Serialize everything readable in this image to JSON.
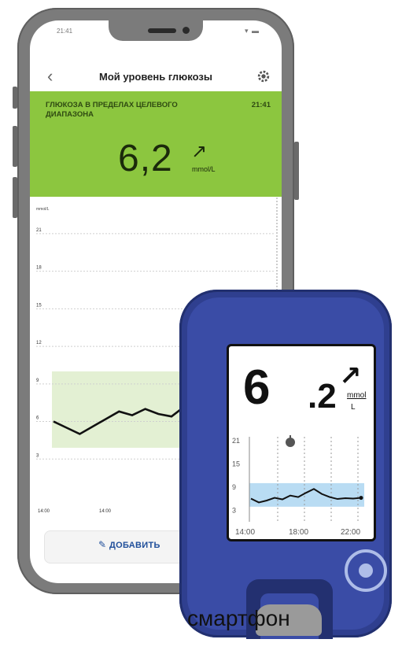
{
  "phone": {
    "status_time": "21:41",
    "status_icons": "▾ ▬",
    "header": {
      "back_glyph": "‹",
      "title": "Мой уровень глюкозы"
    },
    "banner": {
      "status_text": "ГЛЮКОЗА В ПРЕДЕЛАХ ЦЕЛЕВОГО ДИАПАЗОНА",
      "time": "21:41",
      "value": "6,2",
      "trend_arrow": "↗",
      "unit": "mmol/L",
      "color": "#8cc63f"
    },
    "chart_data": {
      "type": "line",
      "unit_label": "mmol/L",
      "y_ticks": [
        "21",
        "18",
        "15",
        "12",
        "9",
        "6",
        "3"
      ],
      "x_ticks": [
        "14:00",
        "14:00",
        "",
        ""
      ],
      "target_range": [
        3.9,
        10.0
      ],
      "ylim": [
        0,
        22
      ],
      "series": [
        {
          "values": [
            6.0,
            5.5,
            5.0,
            5.6,
            6.2,
            6.8,
            6.5,
            7.0,
            6.6,
            6.4,
            7.2,
            8.0,
            9.5
          ]
        }
      ]
    },
    "add_button_label": "ДОБАВИТЬ"
  },
  "reader": {
    "value_int": "6",
    "value_dec": ".2",
    "trend_arrow": "↗",
    "unit_top": "mmol",
    "unit_bottom": "L",
    "chart_data": {
      "type": "line",
      "y_ticks": [
        "21",
        "15",
        "9",
        "3"
      ],
      "x_ticks": [
        "14:00",
        "18:00",
        "22:00"
      ],
      "target_range": [
        3.9,
        10.0
      ],
      "ylim": [
        0,
        22
      ],
      "series": [
        {
          "values": [
            6.0,
            5.0,
            5.5,
            6.2,
            5.8,
            6.8,
            6.4,
            7.5,
            8.5,
            7.2,
            6.4,
            5.9,
            6.1,
            6.0,
            6.2
          ]
        }
      ]
    }
  },
  "caption": "смартфон"
}
